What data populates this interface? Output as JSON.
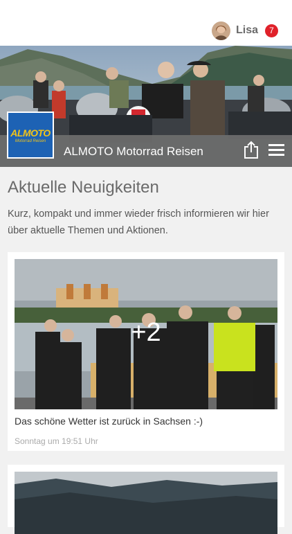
{
  "header": {
    "username": "Lisa",
    "notification_count": "7"
  },
  "banner": {
    "logo_text": "ALMOTO",
    "logo_subtext": "Motorrad Reisen",
    "title": "ALMOTO Motorrad Reisen"
  },
  "news": {
    "heading": "Aktuelle Neuigkeiten",
    "intro": "Kurz, kompakt und immer wieder frisch informieren wir hier über aktuelle Themen und Aktionen.",
    "posts": [
      {
        "more_images": "+2",
        "caption": "Das schöne Wetter ist zurück in Sachsen :-)",
        "time": "Sonntag um 19:51 Uhr"
      }
    ]
  },
  "colors": {
    "badge": "#e0212a",
    "bar": "#6e6e6e",
    "logo_bg": "#1d62b4",
    "logo_text": "#f2c419"
  },
  "icons": [
    "share-icon",
    "hamburger-menu-icon"
  ]
}
